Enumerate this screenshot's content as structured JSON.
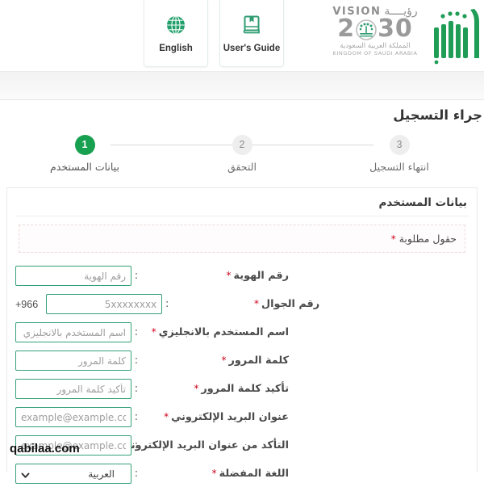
{
  "header": {
    "cards": [
      {
        "id": "english",
        "label": "English",
        "icon": "globe-icon"
      },
      {
        "id": "users-guide",
        "label": "User's Guide",
        "icon": "book-icon"
      }
    ],
    "vision_logo": {
      "word_en": "VISION",
      "word_ar": "رؤيــــة",
      "year_left": "2",
      "year_right": "30",
      "sub_ar": "المملكة العربية السعودية",
      "sub_en": "KINGDOM OF SAUDI ARABIA"
    },
    "gov_logo_name": "absher-logo"
  },
  "page": {
    "title": "جراء التسجيل"
  },
  "stepper": {
    "steps": [
      {
        "number": "1",
        "label": "بيانات المستخدم",
        "active": true
      },
      {
        "number": "2",
        "label": "التحقق",
        "active": false
      },
      {
        "number": "3",
        "label": "انتهاء التسجيل",
        "active": false
      }
    ]
  },
  "form": {
    "panel_title": "بيانات المستخدم",
    "required_note": "حقول مطلوبة",
    "required_star": "*",
    "colon": ":",
    "mobile_prefix": "+966",
    "fields": [
      {
        "name": "national-id",
        "label": "رقم الهوية",
        "required": true,
        "placeholder": "رقم الهوية",
        "type": "text",
        "latin": false
      },
      {
        "name": "mobile-number",
        "label": "رقم الجوال",
        "required": true,
        "placeholder": "5xxxxxxxx",
        "type": "text",
        "latin": true
      },
      {
        "name": "username-english",
        "label": "اسم المستخدم بالانجليزي",
        "required": true,
        "placeholder": "اسم المستخدم بالانجليزي",
        "type": "text",
        "latin": false
      },
      {
        "name": "password",
        "label": "كلمة المرور",
        "required": true,
        "placeholder": "كلمة المرور",
        "type": "password",
        "latin": false
      },
      {
        "name": "confirm-password",
        "label": "تأكيد كلمة المرور",
        "required": true,
        "placeholder": "تأكيد كلمة المرور",
        "type": "password",
        "latin": false
      },
      {
        "name": "email",
        "label": "عنوان البريد الإلكتروني",
        "required": true,
        "placeholder": "example@example.com",
        "type": "text",
        "latin": true
      },
      {
        "name": "confirm-email",
        "label": "التأكد من عنوان البريد الإلكتروني",
        "required": true,
        "placeholder": "example@example.com",
        "type": "text",
        "latin": true
      }
    ],
    "language_field": {
      "name": "preferred-language",
      "label": "اللغة المفضلة",
      "required": true,
      "value": "العربية",
      "options": [
        "العربية"
      ]
    }
  },
  "watermark": "qabilaa.com",
  "colors": {
    "green": "#17a04f",
    "input_border": "#35a177",
    "required_red": "#d0021b",
    "label_text": "#4a4a4a",
    "step_inactive": "#eeeeee"
  }
}
